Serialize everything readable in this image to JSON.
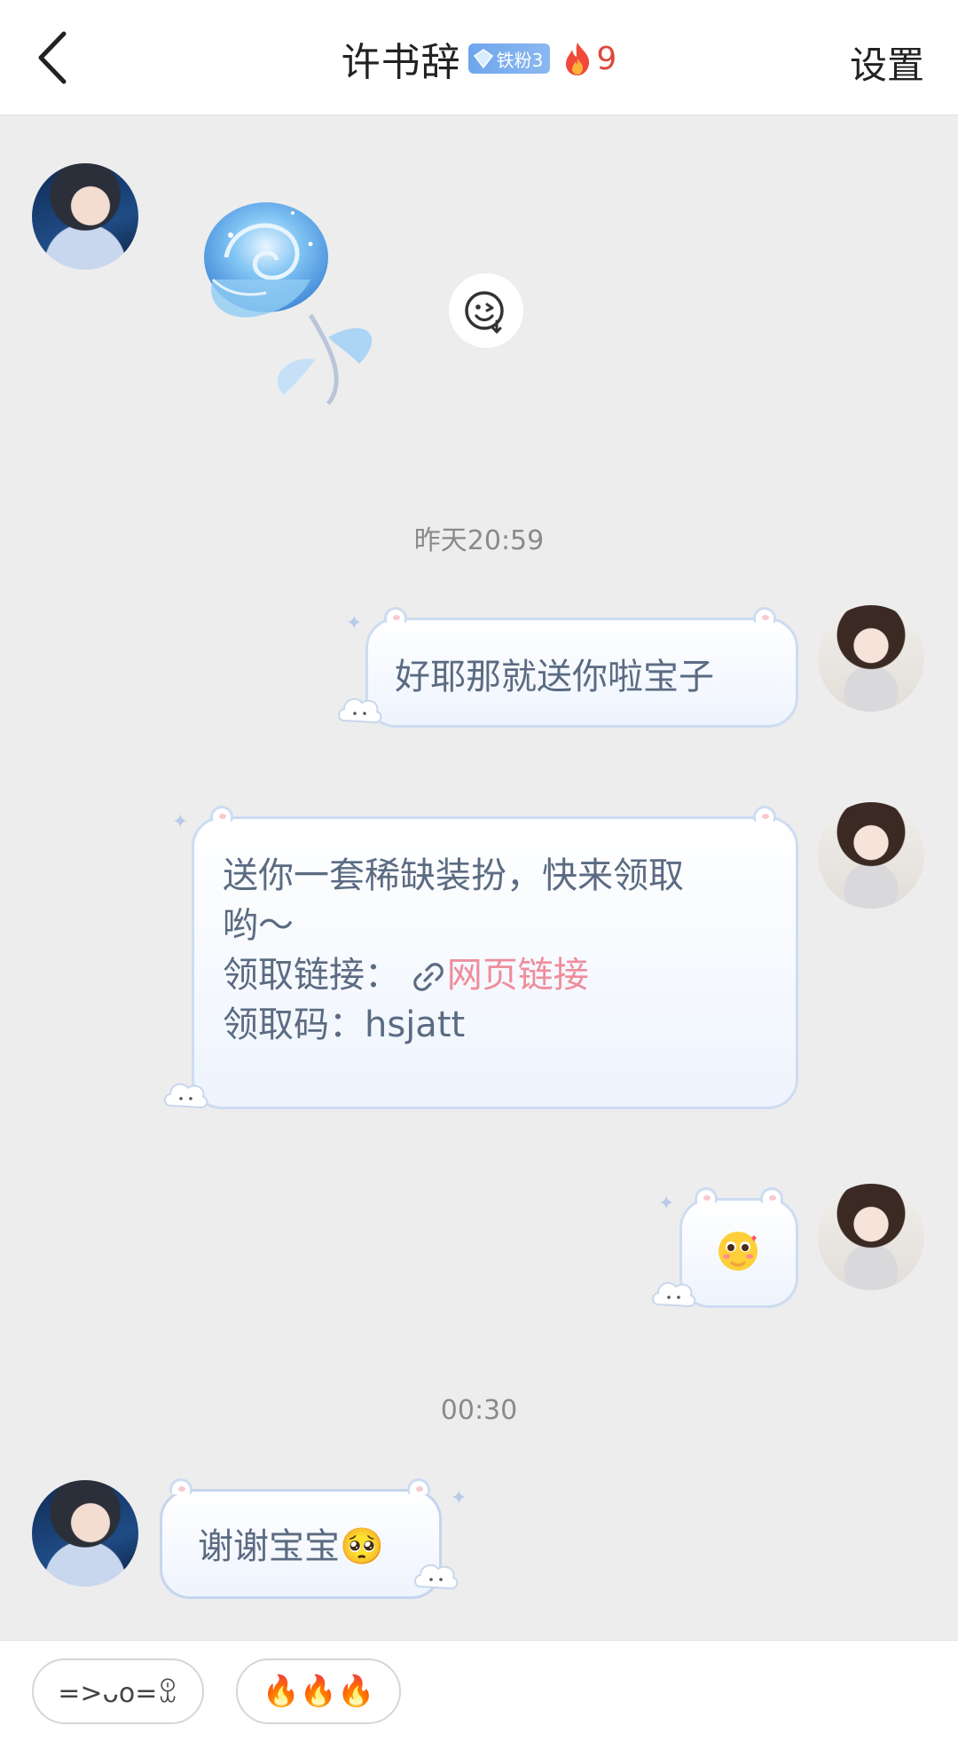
{
  "header": {
    "title": "许书辞",
    "fan_badge_label": "铁粉3",
    "fire_count": "9",
    "settings_label": "设置"
  },
  "messages": {
    "time1": "昨天20:59",
    "msg1": "好耶那就送你啦宝子",
    "msg2_line1": "送你一套稀缺装扮，快来领取",
    "msg2_line2": "哟～",
    "msg2_link_prefix": "领取链接：",
    "msg2_link_text": "网页链接",
    "msg2_code": "领取码：hsjatt",
    "time2": "00:30",
    "msg4": "谢谢宝宝🥺"
  },
  "quick_replies": [
    "=>ᴗo=ꀾ",
    "🔥🔥🔥"
  ],
  "colors": {
    "bubble_border": "#cddcf1",
    "link": "#ef8d9c",
    "fire": "#e0463c",
    "badge": "#6fa6ec"
  }
}
